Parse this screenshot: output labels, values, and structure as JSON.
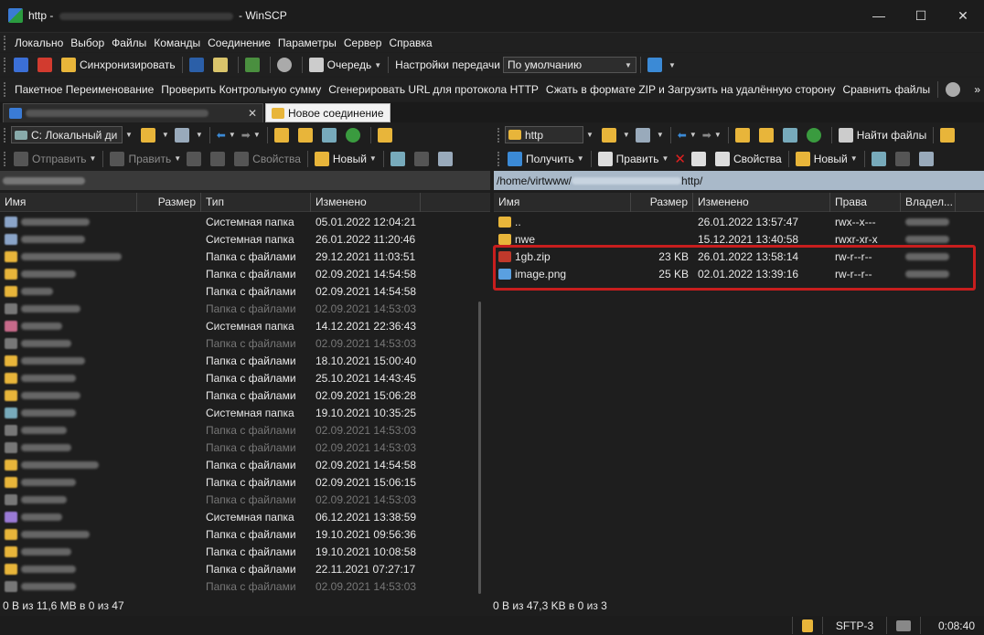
{
  "window": {
    "title_prefix": "http - ",
    "title_suffix": " - WinSCP",
    "minimize": "—",
    "maximize": "☐",
    "close": "✕"
  },
  "menu": [
    "Локально",
    "Выбор",
    "Файлы",
    "Команды",
    "Соединение",
    "Параметры",
    "Сервер",
    "Справка"
  ],
  "toolbar1": {
    "sync_label": "Синхронизировать",
    "queue_label": "Очередь",
    "transfer_settings_label": "Настройки передачи",
    "transfer_preset": "По умолчанию"
  },
  "toolbar2": {
    "batch_rename": "Пакетное Переименование",
    "checksum": "Проверить Контрольную сумму",
    "gen_url": "Сгенерировать URL для протокола HTTP",
    "zip_upload": "Сжать в формате ZIP и Загрузить на удалённую сторону",
    "compare": "Сравнить файлы"
  },
  "tabs": {
    "new_connection": "Новое соединение"
  },
  "left": {
    "drive": "C: Локальный ди",
    "send": "Отправить",
    "edit": "Править",
    "properties": "Свойства",
    "new": "Новый",
    "headers": {
      "name": "Имя",
      "size": "Размер",
      "type": "Тип",
      "modified": "Изменено"
    },
    "rows": [
      {
        "type": "Системная папка",
        "mod": "05.01.2022 12:04:21",
        "dim": false
      },
      {
        "type": "Системная папка",
        "mod": "26.01.2022 11:20:46",
        "dim": false
      },
      {
        "type": "Папка с файлами",
        "mod": "29.12.2021 11:03:51",
        "dim": false
      },
      {
        "type": "Папка с файлами",
        "mod": "02.09.2021 14:54:58",
        "dim": false
      },
      {
        "type": "Папка с файлами",
        "mod": "02.09.2021 14:54:58",
        "dim": false
      },
      {
        "type": "Папка с файлами",
        "mod": "02.09.2021 14:53:03",
        "dim": true
      },
      {
        "type": "Системная папка",
        "mod": "14.12.2021 22:36:43",
        "dim": false
      },
      {
        "type": "Папка с файлами",
        "mod": "02.09.2021 14:53:03",
        "dim": true
      },
      {
        "type": "Папка с файлами",
        "mod": "18.10.2021 15:00:40",
        "dim": false
      },
      {
        "type": "Папка с файлами",
        "mod": "25.10.2021 14:43:45",
        "dim": false
      },
      {
        "type": "Папка с файлами",
        "mod": "02.09.2021 15:06:28",
        "dim": false
      },
      {
        "type": "Системная папка",
        "mod": "19.10.2021 10:35:25",
        "dim": false
      },
      {
        "type": "Папка с файлами",
        "mod": "02.09.2021 14:53:03",
        "dim": true
      },
      {
        "type": "Папка с файлами",
        "mod": "02.09.2021 14:53:03",
        "dim": true
      },
      {
        "type": "Папка с файлами",
        "mod": "02.09.2021 14:54:58",
        "dim": false
      },
      {
        "type": "Папка с файлами",
        "mod": "02.09.2021 15:06:15",
        "dim": false
      },
      {
        "type": "Папка с файлами",
        "mod": "02.09.2021 14:53:03",
        "dim": true
      },
      {
        "type": "Системная папка",
        "mod": "06.12.2021 13:38:59",
        "dim": false
      },
      {
        "type": "Папка с файлами",
        "mod": "19.10.2021 09:56:36",
        "dim": false
      },
      {
        "type": "Папка с файлами",
        "mod": "19.10.2021 10:08:58",
        "dim": false
      },
      {
        "type": "Папка с файлами",
        "mod": "22.11.2021 07:27:17",
        "dim": false
      },
      {
        "type": "Папка с файлами",
        "mod": "02.09.2021 14:53:03",
        "dim": true
      }
    ],
    "status": "0 B из 11,6 MB в 0 из 47"
  },
  "right": {
    "drive": "http",
    "find_files": "Найти файлы",
    "get": "Получить",
    "edit": "Править",
    "properties": "Свойства",
    "new": "Новый",
    "path_prefix": "/home/virtwww/",
    "path_suffix": "http/",
    "headers": {
      "name": "Имя",
      "size": "Размер",
      "modified": "Изменено",
      "perm": "Права",
      "owner": "Владел..."
    },
    "rows": [
      {
        "name": "..",
        "size": "",
        "mod": "26.01.2022 13:57:47",
        "perm": "rwx--x---",
        "icon": "parent-folder-icon"
      },
      {
        "name": "nwe",
        "size": "",
        "mod": "15.12.2021 13:40:58",
        "perm": "rwxr-xr-x",
        "icon": "folder-icon"
      },
      {
        "name": "1gb.zip",
        "size": "23 KB",
        "mod": "26.01.2022 13:58:14",
        "perm": "rw-r--r--",
        "icon": "archive-icon"
      },
      {
        "name": "image.png",
        "size": "25 KB",
        "mod": "02.01.2022 13:39:16",
        "perm": "rw-r--r--",
        "icon": "image-file-icon"
      }
    ],
    "status": "0 B из 47,3 KB в 0 из 3"
  },
  "statusbar": {
    "protocol": "SFTP-3",
    "elapsed": "0:08:40"
  },
  "colors": {
    "highlight": "#c81e1e",
    "folder": "#e8b53a",
    "remote_path_bg": "#a9b9c9"
  }
}
